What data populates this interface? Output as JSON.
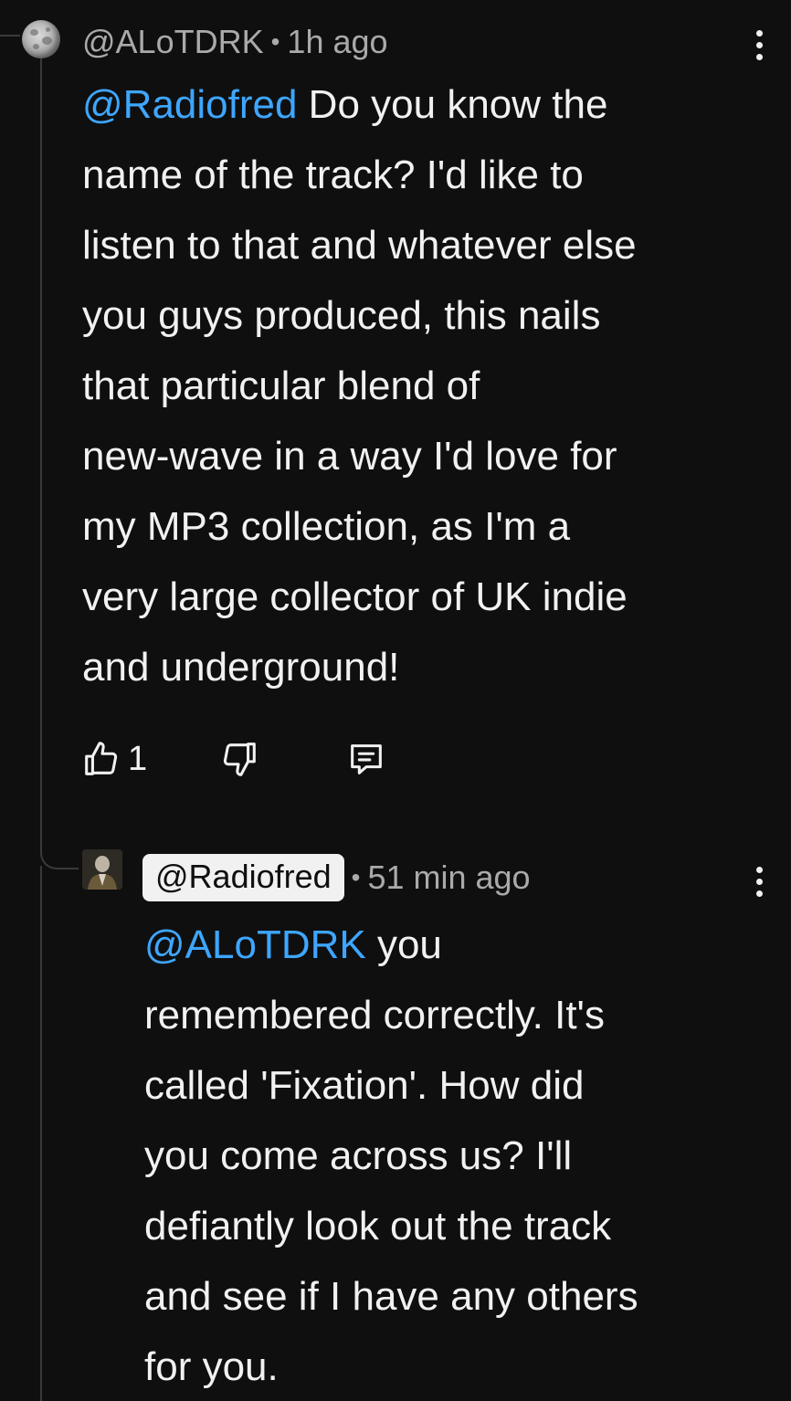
{
  "comment": {
    "author": "@ALoTDRK",
    "separator": "•",
    "time": "1h ago",
    "mention": "@Radiofred",
    "lines": [
      " Do you know the",
      "name of the track? I'd like to",
      "listen to that and whatever else",
      "you guys produced, this nails",
      "that particular blend of",
      "new-wave in a way I'd love for",
      "my MP3 collection, as I'm a",
      "very large collector of UK indie",
      "and underground!"
    ],
    "like_count": "1",
    "icons": {
      "avatar": "moon-avatar",
      "like": "thumbs-up-icon",
      "dislike": "thumbs-down-icon",
      "reply": "reply-icon",
      "menu": "more-vert-icon"
    }
  },
  "reply": {
    "author": "@Radiofred",
    "separator": "•",
    "time": "51 min ago",
    "mention": "@ALoTDRK",
    "lines": [
      " you",
      "remembered correctly. It's",
      "called 'Fixation'. How did",
      "you come across us? I'll",
      "defiantly look out the track",
      "and see if I have any others",
      "for you."
    ],
    "icons": {
      "avatar": "user-avatar",
      "menu": "more-vert-icon"
    }
  },
  "colors": {
    "background": "#0f0f0f",
    "text": "#f1f1f1",
    "secondary_text": "#aaaaaa",
    "mention": "#3ea6ff"
  }
}
